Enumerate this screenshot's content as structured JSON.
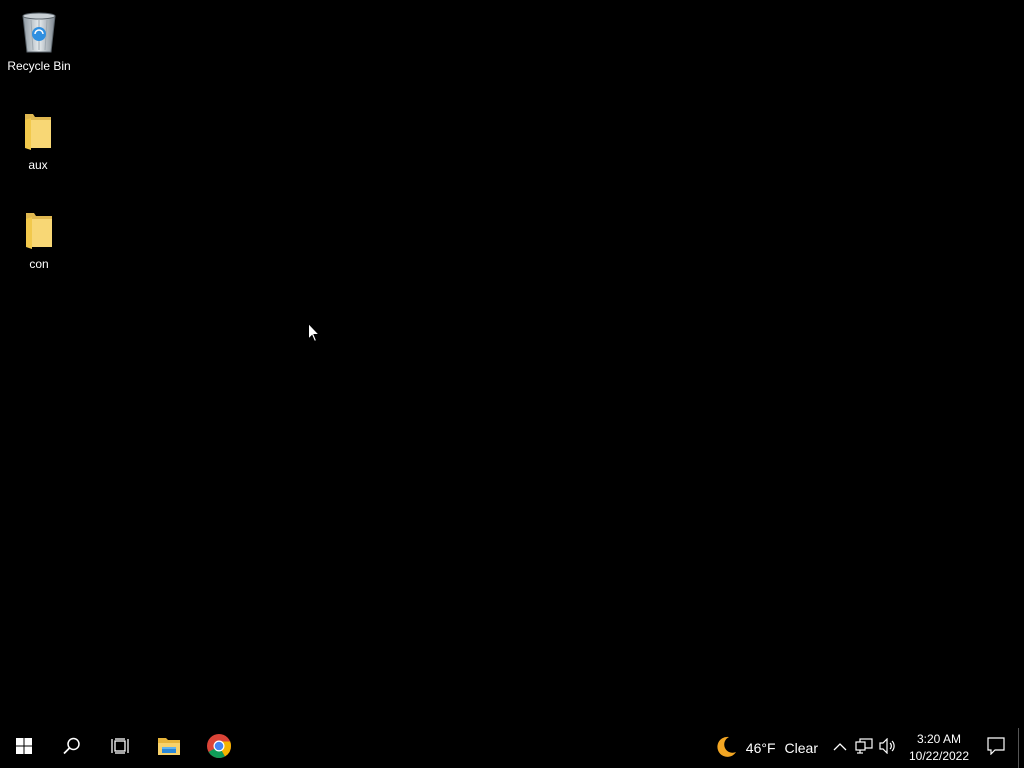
{
  "desktop": {
    "background_color": "#000000",
    "icons": [
      {
        "label": "Recycle Bin",
        "icon": "recycle-bin-icon"
      },
      {
        "label": "aux",
        "icon": "folder-icon"
      },
      {
        "label": "con",
        "icon": "folder-icon"
      }
    ]
  },
  "taskbar": {
    "start": {
      "icon": "windows-logo-icon"
    },
    "search": {
      "icon": "search-icon"
    },
    "task_view": {
      "icon": "task-view-icon"
    },
    "pinned_apps": [
      {
        "name": "File Explorer",
        "icon": "file-explorer-icon"
      },
      {
        "name": "Google Chrome",
        "icon": "chrome-icon"
      }
    ],
    "weather": {
      "icon": "moon-icon",
      "temperature": "46°F",
      "condition": "Clear"
    },
    "tray": {
      "show_hidden_icon": "chevron-up-icon",
      "network_icon": "network-icon",
      "volume_icon": "volume-icon"
    },
    "clock": {
      "time": "3:20 AM",
      "date": "10/22/2022"
    },
    "notifications": {
      "icon": "action-center-icon"
    }
  }
}
